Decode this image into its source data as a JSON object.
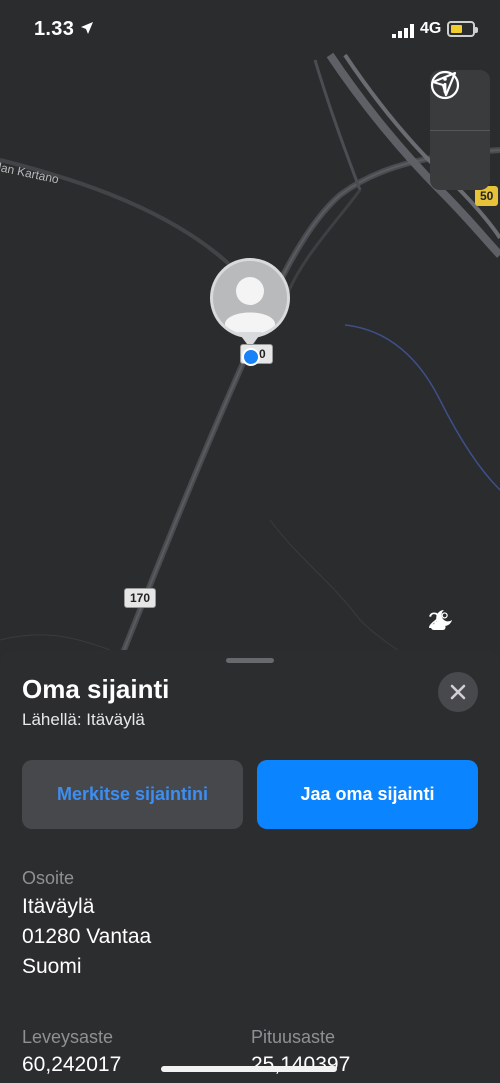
{
  "status_bar": {
    "time": "1.33",
    "network": "4G"
  },
  "map": {
    "place_label": "lan Kartano",
    "route_shield_1": "170",
    "route_shield_2": "50",
    "route_shield_pin": "0",
    "weather_temp": "2°",
    "icons": {
      "info": "info-icon",
      "locate": "location-arrow-icon",
      "weather": "partly-cloudy-night-icon"
    }
  },
  "sheet": {
    "title": "Oma sijainti",
    "subtitle": "Lähellä: Itäväylä",
    "mark_button": "Merkitse sijaintini",
    "share_button": "Jaa oma sijainti",
    "address_label": "Osoite",
    "address_lines": [
      "Itäväylä",
      "01280 Vantaa",
      "Suomi"
    ],
    "latitude_label": "Leveysaste",
    "latitude_value": "60,242017",
    "longitude_label": "Pituusaste",
    "longitude_value": "25,140397"
  },
  "colors": {
    "accent": "#0a84ff",
    "battery": "#f0cc2f",
    "route_yellow": "#e5c23a"
  }
}
